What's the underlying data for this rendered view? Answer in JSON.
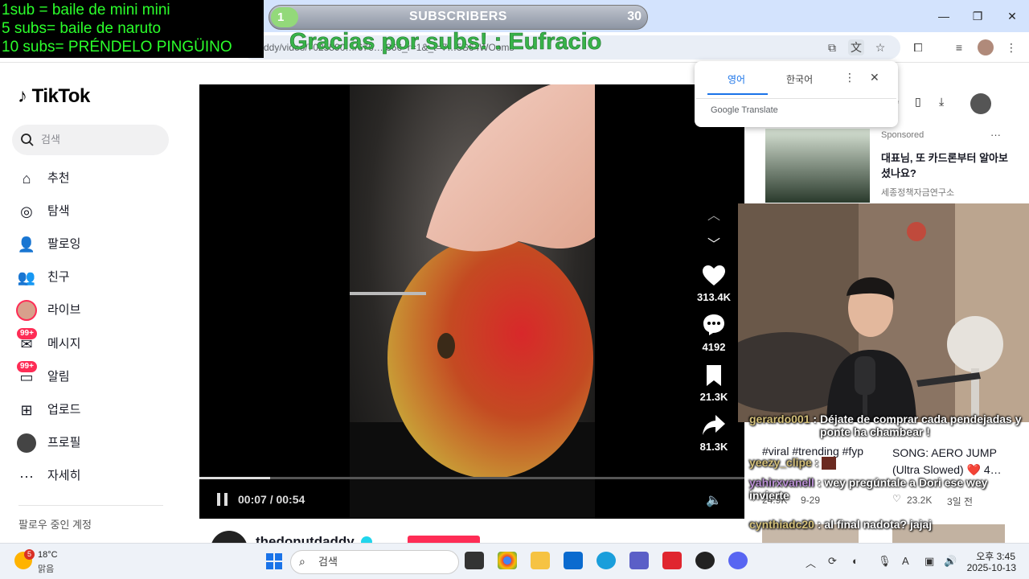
{
  "browser": {
    "url_fragment": "ddy/video/7025590…/676…/366_r=1&_t=7…5S64WOoms"
  },
  "stream_overlay": {
    "rules": [
      "1sub = baile de mini mini",
      "5 subs= baile de naruto",
      "10 subs= PRÉNDELO PINGÜINO"
    ],
    "sub_count": "1",
    "sub_label": "SUBSCRIBERS",
    "sub_goal": "30",
    "thanks": "Gracias por subs! : Eufracio"
  },
  "tiktok": {
    "logo": "TikTok",
    "search_placeholder": "검색",
    "nav": [
      {
        "label": "추천",
        "icon": "home-icon"
      },
      {
        "label": "탐색",
        "icon": "compass-icon"
      },
      {
        "label": "팔로잉",
        "icon": "following-icon"
      },
      {
        "label": "친구",
        "icon": "friends-icon"
      },
      {
        "label": "라이브",
        "icon": "live-icon"
      },
      {
        "label": "메시지",
        "icon": "message-icon",
        "badge": "99+"
      },
      {
        "label": "알림",
        "icon": "notification-icon",
        "badge": "99+"
      },
      {
        "label": "업로드",
        "icon": "upload-icon"
      },
      {
        "label": "프로필",
        "icon": "profile-icon"
      },
      {
        "label": "자세히",
        "icon": "more-icon"
      }
    ],
    "following_header": "팔로우 중인 계정",
    "video": {
      "time": "00:07 / 00:54",
      "progress": 0.13,
      "likes": "313.4K",
      "comments": "4192",
      "saves": "21.3K",
      "shares": "81.3K",
      "author": "thedonutdaddy"
    },
    "sponsored": {
      "label": "Sponsored",
      "title": "대표님, 또 카드론부터 알아보셨나요?",
      "source": "세종정책자금연구소"
    },
    "cards": [
      {
        "title": "#viral #trending #fyp",
        "likes": "24.9K",
        "date": "9-29"
      },
      {
        "title": "SONG: AERO JUMP (Ultra Slowed) ❤️ 4…",
        "likes": "23.2K",
        "date": "3일 전"
      }
    ]
  },
  "translate_popup": {
    "tab_source": "영어",
    "tab_target": "한국어",
    "brand": "Google Translate"
  },
  "chat": [
    {
      "user": "gerardo001",
      "text": "Déjate de comprar cada pendejadas y ponte ha chambear !"
    },
    {
      "user": "yeezy_clipe",
      "text": ":"
    },
    {
      "user": "yahirxvanell",
      "text": "wey pregúntale a Dori ese wey invierte"
    },
    {
      "user": "cynthiadc20",
      "text": "al final nadota? jajaj"
    }
  ],
  "taskbar": {
    "weather_badge": "5",
    "temp": "18°C",
    "condition": "맑음",
    "search_placeholder": "검색",
    "time": "오후 3:45",
    "date": "2025-10-13"
  },
  "colors": {
    "tiktok_accent": "#fe2c55",
    "overlay_green": "#2bff2b",
    "chrome_blue": "#d3e3fd"
  }
}
